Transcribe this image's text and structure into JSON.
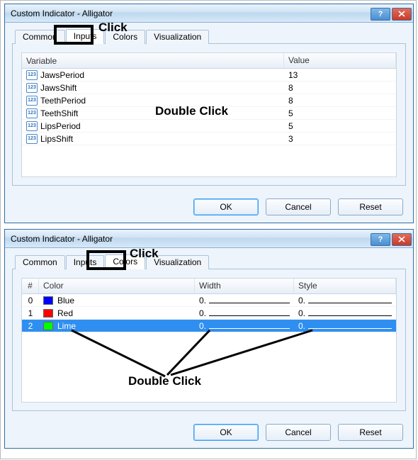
{
  "dialog1": {
    "title": "Custom Indicator - Alligator",
    "tabs": [
      "Common",
      "Inputs",
      "Colors",
      "Visualization"
    ],
    "active_tab": "Inputs",
    "table": {
      "headers": [
        "Variable",
        "Value"
      ],
      "rows": [
        {
          "name": "JawsPeriod",
          "value": "13"
        },
        {
          "name": "JawsShift",
          "value": "8"
        },
        {
          "name": "TeethPeriod",
          "value": "8"
        },
        {
          "name": "TeethShift",
          "value": "5"
        },
        {
          "name": "LipsPeriod",
          "value": "5"
        },
        {
          "name": "LipsShift",
          "value": "3"
        }
      ]
    },
    "buttons": {
      "ok": "OK",
      "cancel": "Cancel",
      "reset": "Reset"
    }
  },
  "dialog2": {
    "title": "Custom Indicator - Alligator",
    "tabs": [
      "Common",
      "Inputs",
      "Colors",
      "Visualization"
    ],
    "active_tab": "Colors",
    "table": {
      "headers": [
        "#",
        "Color",
        "Width",
        "Style"
      ],
      "rows": [
        {
          "idx": "0",
          "color_name": "Blue",
          "color_hex": "#0000ff",
          "width": "0.",
          "style": "0.",
          "selected": false
        },
        {
          "idx": "1",
          "color_name": "Red",
          "color_hex": "#ff0000",
          "width": "0.",
          "style": "0.",
          "selected": false
        },
        {
          "idx": "2",
          "color_name": "Lime",
          "color_hex": "#00ff00",
          "width": "0.",
          "style": "0.",
          "selected": true
        }
      ]
    },
    "buttons": {
      "ok": "OK",
      "cancel": "Cancel",
      "reset": "Reset"
    }
  },
  "annotations": {
    "click1": "Click",
    "doubleclick1": "Double Click",
    "click2": "Click",
    "doubleclick2": "Double Click"
  }
}
